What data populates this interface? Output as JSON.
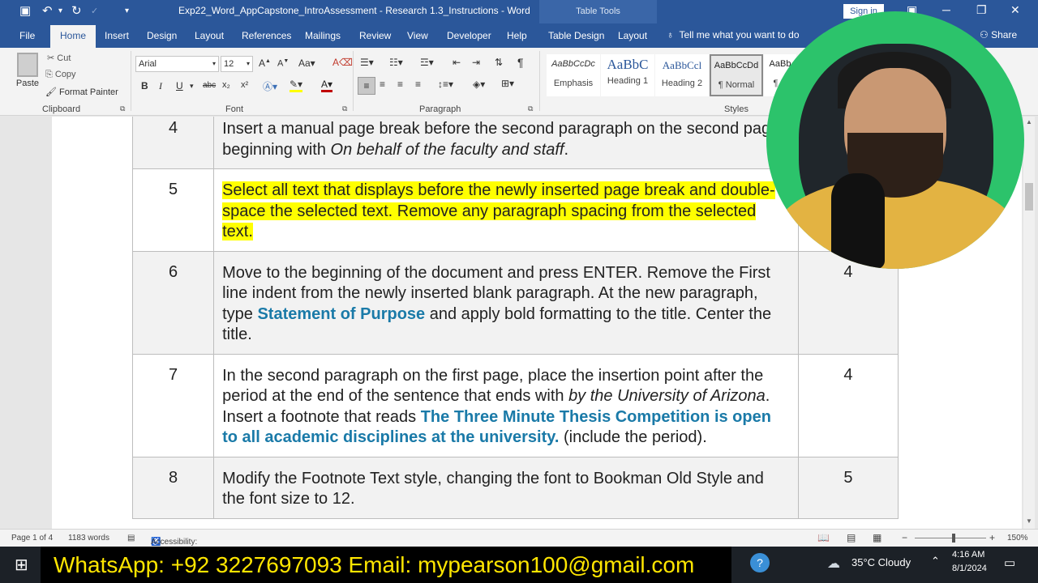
{
  "titlebar": {
    "doc_title": "Exp22_Word_AppCapstone_IntroAssessment - Research 1.3_Instructions - Word",
    "table_tools": "Table Tools",
    "sign_in": "Sign in"
  },
  "tabs": {
    "items": [
      "File",
      "Home",
      "Insert",
      "Design",
      "Layout",
      "References",
      "Mailings",
      "Review",
      "View",
      "Developer",
      "Help",
      "Table Design",
      "Layout"
    ],
    "active": "Home",
    "tell_me": "Tell me what you want to do",
    "share": "Share"
  },
  "ribbon": {
    "clipboard": {
      "label": "Clipboard",
      "paste": "Paste",
      "cut": "Cut",
      "copy": "Copy",
      "format_painter": "Format Painter"
    },
    "font": {
      "label": "Font",
      "name": "Arial",
      "size": "12",
      "bold": "B",
      "italic": "I",
      "underline": "U",
      "strike": "abc",
      "sub": "x₂",
      "sup": "x²"
    },
    "paragraph": {
      "label": "Paragraph"
    },
    "styles": {
      "label": "Styles",
      "items": [
        {
          "preview": "AaBbCcDc",
          "name": "Emphasis"
        },
        {
          "preview": "AaBbC",
          "name": "Heading 1"
        },
        {
          "preview": "AaBbCcl",
          "name": "Heading 2"
        },
        {
          "preview": "AaBbCcDd",
          "name": "¶ Normal"
        },
        {
          "preview": "AaBb",
          "name": "¶ N"
        }
      ]
    }
  },
  "table": {
    "rows": [
      {
        "num": "4",
        "segments": [
          {
            "t": "Insert a manual page break before the second paragraph on the second page, beginning with "
          },
          {
            "t": "On behalf of the faculty and staff",
            "style": "italic"
          },
          {
            "t": "."
          }
        ],
        "points": "",
        "gray": true
      },
      {
        "num": "5",
        "segments": [
          {
            "t": "Select all text that displays before the newly inserted page break and double-space the selected text. Remove any paragraph spacing from the selected text.",
            "style": "highlight"
          }
        ],
        "points": "",
        "gray": false
      },
      {
        "num": "6",
        "segments": [
          {
            "t": "Move to the beginning of the document and press ENTER. Remove the First line indent from the newly inserted blank paragraph. At the new paragraph, type "
          },
          {
            "t": "Statement of Purpose",
            "style": "blue"
          },
          {
            "t": " and apply bold formatting to the title. Center the title."
          }
        ],
        "points": "4",
        "gray": true
      },
      {
        "num": "7",
        "segments": [
          {
            "t": "In the second paragraph on the first page, place the insertion point after the period at the end of the sentence that ends with "
          },
          {
            "t": "by the University of Arizona",
            "style": "italic"
          },
          {
            "t": ". Insert a footnote that reads "
          },
          {
            "t": "The Three Minute Thesis Competition is open to all academic disciplines at the university.",
            "style": "blue"
          },
          {
            "t": " (include the period)."
          }
        ],
        "points": "4",
        "gray": false
      },
      {
        "num": "8",
        "segments": [
          {
            "t": "Modify the Footnote Text style, changing the font to Bookman Old Style and the font size to 12."
          }
        ],
        "points": "5",
        "gray": true
      }
    ]
  },
  "statusbar": {
    "page": "Page 1 of 4",
    "words": "1183 words",
    "accessibility": "Accessibility: Investigate",
    "zoom": "150%"
  },
  "taskbar": {
    "banner": "WhatsApp: +92 3227697093  Email: mypearson100@gmail.com",
    "weather": "35°C  Cloudy",
    "time": "4:16 AM",
    "date": "8/1/2024"
  },
  "colors": {
    "word_blue": "#2b579a",
    "highlight": "#ffff00",
    "link_blue": "#1a7aa8",
    "banner_text": "#ffe600"
  }
}
